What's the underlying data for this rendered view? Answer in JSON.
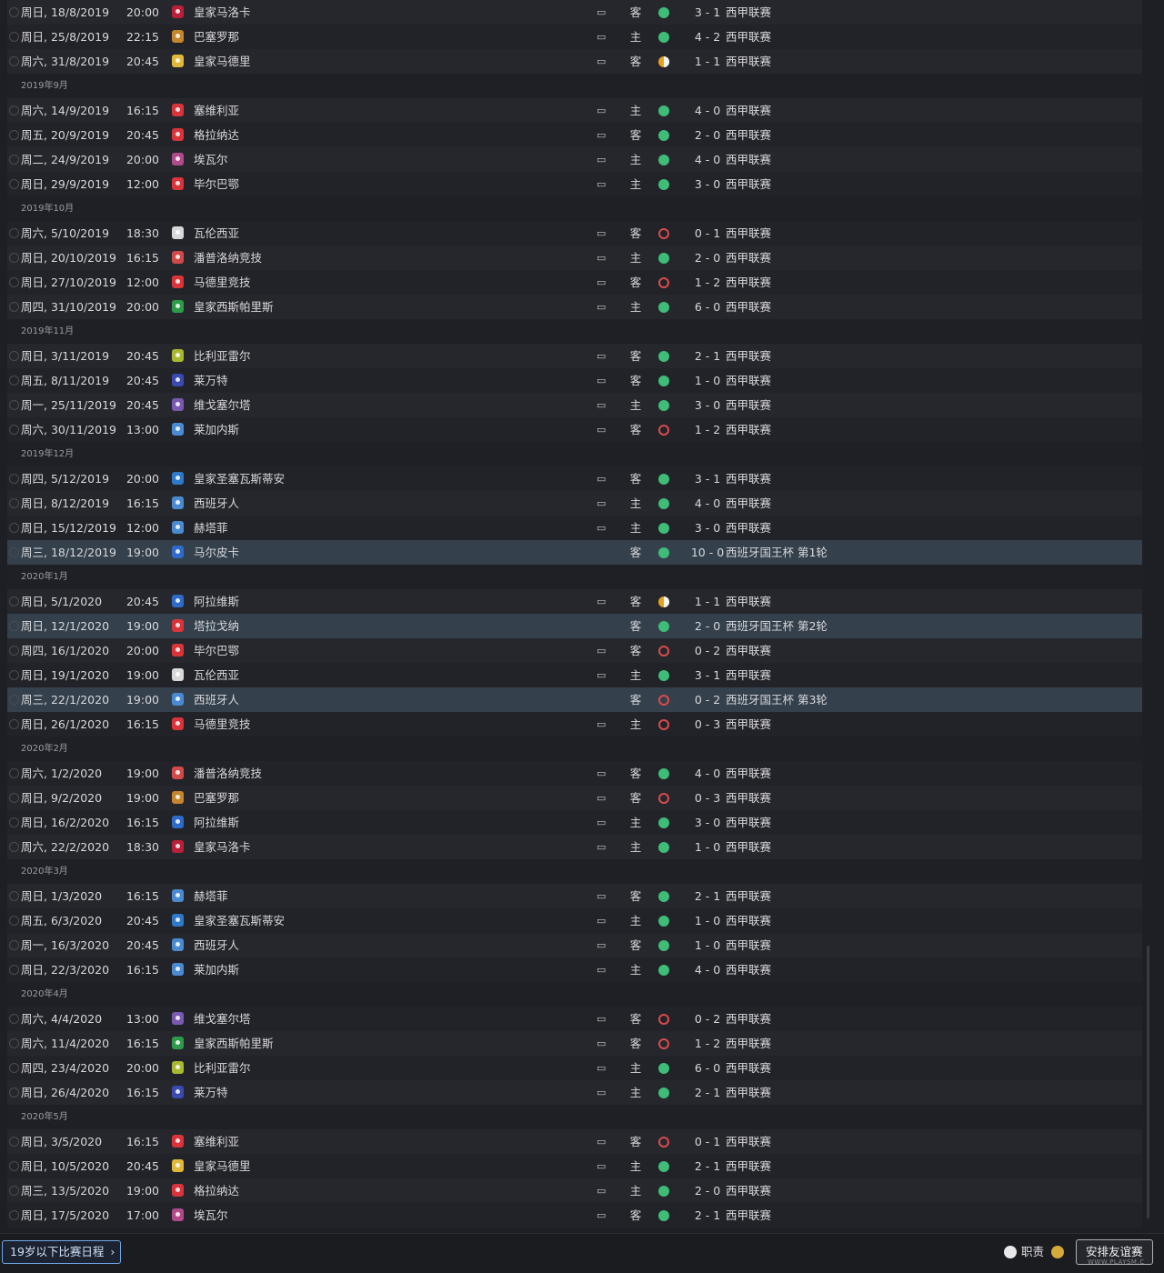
{
  "schedule": [
    {
      "type": "fixture",
      "date": "周日, 18/8/2019",
      "time": "20:00",
      "badge_color": "#b8203a",
      "opponent": "皇家马洛卡",
      "tv": "▭",
      "venue": "客",
      "result": "w",
      "score": "3 - 1",
      "competition": "西甲联赛"
    },
    {
      "type": "fixture",
      "date": "周日, 25/8/2019",
      "time": "22:15",
      "badge_color": "#c4862e",
      "opponent": "巴塞罗那",
      "tv": "▭",
      "venue": "主",
      "result": "w",
      "score": "4 - 2",
      "competition": "西甲联赛"
    },
    {
      "type": "fixture",
      "date": "周六, 31/8/2019",
      "time": "20:45",
      "badge_color": "#e0b83a",
      "opponent": "皇家马德里",
      "tv": "▭",
      "venue": "客",
      "result": "d",
      "score": "1 - 1",
      "competition": "西甲联赛"
    },
    {
      "type": "month",
      "label": "2019年9月"
    },
    {
      "type": "fixture",
      "date": "周六, 14/9/2019",
      "time": "16:15",
      "badge_color": "#d8343a",
      "opponent": "塞维利亚",
      "tv": "▭",
      "venue": "主",
      "result": "w",
      "score": "4 - 0",
      "competition": "西甲联赛"
    },
    {
      "type": "fixture",
      "date": "周五, 20/9/2019",
      "time": "20:45",
      "badge_color": "#d8343a",
      "opponent": "格拉纳达",
      "tv": "▭",
      "venue": "客",
      "result": "w",
      "score": "2 - 0",
      "competition": "西甲联赛"
    },
    {
      "type": "fixture",
      "date": "周二, 24/9/2019",
      "time": "20:00",
      "badge_color": "#b04a8a",
      "opponent": "埃瓦尔",
      "tv": "▭",
      "venue": "主",
      "result": "w",
      "score": "4 - 0",
      "competition": "西甲联赛"
    },
    {
      "type": "fixture",
      "date": "周日, 29/9/2019",
      "time": "12:00",
      "badge_color": "#d8343a",
      "opponent": "毕尔巴鄂",
      "tv": "▭",
      "venue": "主",
      "result": "w",
      "score": "3 - 0",
      "competition": "西甲联赛"
    },
    {
      "type": "month",
      "label": "2019年10月"
    },
    {
      "type": "fixture",
      "date": "周六, 5/10/2019",
      "time": "18:30",
      "badge_color": "#d8d8d8",
      "opponent": "瓦伦西亚",
      "tv": "▭",
      "venue": "客",
      "result": "l",
      "score": "0 - 1",
      "competition": "西甲联赛"
    },
    {
      "type": "fixture",
      "date": "周日, 20/10/2019",
      "time": "16:15",
      "badge_color": "#d04a4a",
      "opponent": "潘普洛纳竞技",
      "tv": "▭",
      "venue": "主",
      "result": "w",
      "score": "2 - 0",
      "competition": "西甲联赛"
    },
    {
      "type": "fixture",
      "date": "周日, 27/10/2019",
      "time": "12:00",
      "badge_color": "#d8343a",
      "opponent": "马德里竞技",
      "tv": "▭",
      "venue": "客",
      "result": "l",
      "score": "1 - 2",
      "competition": "西甲联赛"
    },
    {
      "type": "fixture",
      "date": "周四, 31/10/2019",
      "time": "20:00",
      "badge_color": "#2e9a4a",
      "opponent": "皇家西斯帕里斯",
      "tv": "▭",
      "venue": "主",
      "result": "w",
      "score": "6 - 0",
      "competition": "西甲联赛"
    },
    {
      "type": "month",
      "label": "2019年11月"
    },
    {
      "type": "fixture",
      "date": "周日, 3/11/2019",
      "time": "20:45",
      "badge_color": "#a8b830",
      "opponent": "比利亚雷尔",
      "tv": "▭",
      "venue": "客",
      "result": "w",
      "score": "2 - 1",
      "competition": "西甲联赛"
    },
    {
      "type": "fixture",
      "date": "周五, 8/11/2019",
      "time": "20:45",
      "badge_color": "#3a4ab0",
      "opponent": "莱万特",
      "tv": "▭",
      "venue": "客",
      "result": "w",
      "score": "1 - 0",
      "competition": "西甲联赛"
    },
    {
      "type": "fixture",
      "date": "周一, 25/11/2019",
      "time": "20:45",
      "badge_color": "#7a5ab0",
      "opponent": "维戈塞尔塔",
      "tv": "▭",
      "venue": "主",
      "result": "w",
      "score": "3 - 0",
      "competition": "西甲联赛"
    },
    {
      "type": "fixture",
      "date": "周六, 30/11/2019",
      "time": "13:00",
      "badge_color": "#4a8ad0",
      "opponent": "莱加内斯",
      "tv": "▭",
      "venue": "客",
      "result": "l",
      "score": "1 - 2",
      "competition": "西甲联赛"
    },
    {
      "type": "month",
      "label": "2019年12月"
    },
    {
      "type": "fixture",
      "date": "周四, 5/12/2019",
      "time": "20:00",
      "badge_color": "#2e7ac8",
      "opponent": "皇家圣塞瓦斯蒂安",
      "tv": "▭",
      "venue": "客",
      "result": "w",
      "score": "3 - 1",
      "competition": "西甲联赛"
    },
    {
      "type": "fixture",
      "date": "周日, 8/12/2019",
      "time": "16:15",
      "badge_color": "#4a8ad0",
      "opponent": "西班牙人",
      "tv": "▭",
      "venue": "主",
      "result": "w",
      "score": "4 - 0",
      "competition": "西甲联赛"
    },
    {
      "type": "fixture",
      "date": "周日, 15/12/2019",
      "time": "12:00",
      "badge_color": "#4a8ad0",
      "opponent": "赫塔菲",
      "tv": "▭",
      "venue": "主",
      "result": "w",
      "score": "3 - 0",
      "competition": "西甲联赛"
    },
    {
      "type": "fixture",
      "cup": true,
      "date": "周三, 18/12/2019",
      "time": "19:00",
      "badge_color": "#2e6ac8",
      "opponent": "马尔皮卡",
      "tv": "",
      "venue": "客",
      "result": "w",
      "score": "10 - 0",
      "competition": "西班牙国王杯 第1轮"
    },
    {
      "type": "month",
      "label": "2020年1月"
    },
    {
      "type": "fixture",
      "date": "周日, 5/1/2020",
      "time": "20:45",
      "badge_color": "#2e6ac8",
      "opponent": "阿拉维斯",
      "tv": "▭",
      "venue": "客",
      "result": "d",
      "score": "1 - 1",
      "competition": "西甲联赛"
    },
    {
      "type": "fixture",
      "cup": true,
      "date": "周日, 12/1/2020",
      "time": "19:00",
      "badge_color": "#d8343a",
      "opponent": "塔拉戈纳",
      "tv": "",
      "venue": "客",
      "result": "w",
      "score": "2 - 0",
      "competition": "西班牙国王杯 第2轮"
    },
    {
      "type": "fixture",
      "date": "周四, 16/1/2020",
      "time": "20:00",
      "badge_color": "#d8343a",
      "opponent": "毕尔巴鄂",
      "tv": "▭",
      "venue": "客",
      "result": "l",
      "score": "0 - 2",
      "competition": "西甲联赛"
    },
    {
      "type": "fixture",
      "date": "周日, 19/1/2020",
      "time": "19:00",
      "badge_color": "#d8d8d8",
      "opponent": "瓦伦西亚",
      "tv": "▭",
      "venue": "主",
      "result": "w",
      "score": "3 - 1",
      "competition": "西甲联赛"
    },
    {
      "type": "fixture",
      "cup": true,
      "date": "周三, 22/1/2020",
      "time": "19:00",
      "badge_color": "#4a8ad0",
      "opponent": "西班牙人",
      "tv": "",
      "venue": "客",
      "result": "l",
      "score": "0 - 2",
      "competition": "西班牙国王杯 第3轮"
    },
    {
      "type": "fixture",
      "date": "周日, 26/1/2020",
      "time": "16:15",
      "badge_color": "#d8343a",
      "opponent": "马德里竞技",
      "tv": "▭",
      "venue": "主",
      "result": "l",
      "score": "0 - 3",
      "competition": "西甲联赛"
    },
    {
      "type": "month",
      "label": "2020年2月"
    },
    {
      "type": "fixture",
      "date": "周六, 1/2/2020",
      "time": "19:00",
      "badge_color": "#d04a4a",
      "opponent": "潘普洛纳竞技",
      "tv": "▭",
      "venue": "客",
      "result": "w",
      "score": "4 - 0",
      "competition": "西甲联赛"
    },
    {
      "type": "fixture",
      "date": "周日, 9/2/2020",
      "time": "19:00",
      "badge_color": "#c4862e",
      "opponent": "巴塞罗那",
      "tv": "▭",
      "venue": "客",
      "result": "l",
      "score": "0 - 3",
      "competition": "西甲联赛"
    },
    {
      "type": "fixture",
      "date": "周日, 16/2/2020",
      "time": "16:15",
      "badge_color": "#2e6ac8",
      "opponent": "阿拉维斯",
      "tv": "▭",
      "venue": "主",
      "result": "w",
      "score": "3 - 0",
      "competition": "西甲联赛"
    },
    {
      "type": "fixture",
      "date": "周六, 22/2/2020",
      "time": "18:30",
      "badge_color": "#b8203a",
      "opponent": "皇家马洛卡",
      "tv": "▭",
      "venue": "主",
      "result": "w",
      "score": "1 - 0",
      "competition": "西甲联赛"
    },
    {
      "type": "month",
      "label": "2020年3月"
    },
    {
      "type": "fixture",
      "date": "周日, 1/3/2020",
      "time": "16:15",
      "badge_color": "#4a8ad0",
      "opponent": "赫塔菲",
      "tv": "▭",
      "venue": "客",
      "result": "w",
      "score": "2 - 1",
      "competition": "西甲联赛"
    },
    {
      "type": "fixture",
      "date": "周五, 6/3/2020",
      "time": "20:45",
      "badge_color": "#2e7ac8",
      "opponent": "皇家圣塞瓦斯蒂安",
      "tv": "▭",
      "venue": "主",
      "result": "w",
      "score": "1 - 0",
      "competition": "西甲联赛"
    },
    {
      "type": "fixture",
      "date": "周一, 16/3/2020",
      "time": "20:45",
      "badge_color": "#4a8ad0",
      "opponent": "西班牙人",
      "tv": "▭",
      "venue": "客",
      "result": "w",
      "score": "1 - 0",
      "competition": "西甲联赛"
    },
    {
      "type": "fixture",
      "date": "周日, 22/3/2020",
      "time": "16:15",
      "badge_color": "#4a8ad0",
      "opponent": "莱加内斯",
      "tv": "▭",
      "venue": "主",
      "result": "w",
      "score": "4 - 0",
      "competition": "西甲联赛"
    },
    {
      "type": "month",
      "label": "2020年4月"
    },
    {
      "type": "fixture",
      "date": "周六, 4/4/2020",
      "time": "13:00",
      "badge_color": "#7a5ab0",
      "opponent": "维戈塞尔塔",
      "tv": "▭",
      "venue": "客",
      "result": "l",
      "score": "0 - 2",
      "competition": "西甲联赛"
    },
    {
      "type": "fixture",
      "date": "周六, 11/4/2020",
      "time": "16:15",
      "badge_color": "#2e9a4a",
      "opponent": "皇家西斯帕里斯",
      "tv": "▭",
      "venue": "客",
      "result": "l",
      "score": "1 - 2",
      "competition": "西甲联赛"
    },
    {
      "type": "fixture",
      "date": "周四, 23/4/2020",
      "time": "20:00",
      "badge_color": "#a8b830",
      "opponent": "比利亚雷尔",
      "tv": "▭",
      "venue": "主",
      "result": "w",
      "score": "6 - 0",
      "competition": "西甲联赛"
    },
    {
      "type": "fixture",
      "date": "周日, 26/4/2020",
      "time": "16:15",
      "badge_color": "#3a4ab0",
      "opponent": "莱万特",
      "tv": "▭",
      "venue": "主",
      "result": "w",
      "score": "2 - 1",
      "competition": "西甲联赛"
    },
    {
      "type": "month",
      "label": "2020年5月"
    },
    {
      "type": "fixture",
      "date": "周日, 3/5/2020",
      "time": "16:15",
      "badge_color": "#d8343a",
      "opponent": "塞维利亚",
      "tv": "▭",
      "venue": "客",
      "result": "l",
      "score": "0 - 1",
      "competition": "西甲联赛"
    },
    {
      "type": "fixture",
      "date": "周日, 10/5/2020",
      "time": "20:45",
      "badge_color": "#e0b83a",
      "opponent": "皇家马德里",
      "tv": "▭",
      "venue": "主",
      "result": "w",
      "score": "2 - 1",
      "competition": "西甲联赛"
    },
    {
      "type": "fixture",
      "date": "周三, 13/5/2020",
      "time": "19:00",
      "badge_color": "#d8343a",
      "opponent": "格拉纳达",
      "tv": "▭",
      "venue": "主",
      "result": "w",
      "score": "2 - 0",
      "competition": "西甲联赛"
    },
    {
      "type": "fixture",
      "date": "周日, 17/5/2020",
      "time": "17:00",
      "badge_color": "#b04a8a",
      "opponent": "埃瓦尔",
      "tv": "▭",
      "venue": "客",
      "result": "w",
      "score": "2 - 1",
      "competition": "西甲联赛"
    }
  ],
  "bottom_bar": {
    "u19_label": "19岁以下比赛日程",
    "u19_chevron": "›",
    "duty_label": "职责",
    "arrange_label": "安排友谊赛",
    "watermark": "WWW.PLAYSM.C"
  },
  "colors": {
    "win": "#3ebc78",
    "loss": "#d84b50",
    "draw": "#e6a31a",
    "cup_row": "#34404b"
  }
}
